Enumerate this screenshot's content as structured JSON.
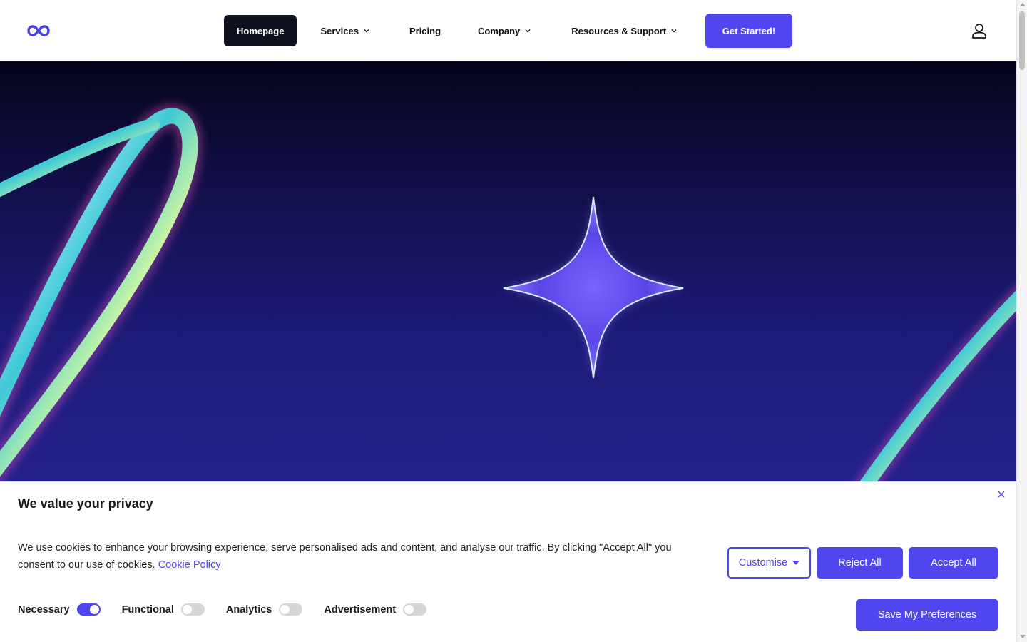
{
  "header": {
    "logo_icon": "infinity-logo-icon",
    "nav": [
      {
        "label": "Homepage",
        "active": true,
        "has_dropdown": false
      },
      {
        "label": "Services",
        "active": false,
        "has_dropdown": true
      },
      {
        "label": "Pricing",
        "active": false,
        "has_dropdown": false
      },
      {
        "label": "Company",
        "active": false,
        "has_dropdown": true
      },
      {
        "label": "Resources & Support",
        "active": false,
        "has_dropdown": true
      }
    ],
    "cta_label": "Get Started!",
    "user_icon": "user-icon"
  },
  "hero": {
    "decor_icons": [
      "sparkle-star-icon",
      "holographic-ring-left",
      "holographic-ring-right"
    ]
  },
  "cookie": {
    "title": "We value your privacy",
    "text": "We use cookies to enhance your browsing experience, serve personalised ads and content, and analyse our traffic. By clicking \"Accept All\" you consent to our use of cookies.",
    "link_label": "Cookie Policy",
    "customise_label": "Customise",
    "reject_label": "Reject All",
    "accept_label": "Accept All",
    "save_label": "Save My Preferences",
    "close_icon": "close-icon",
    "preferences": [
      {
        "label": "Necessary",
        "on": true
      },
      {
        "label": "Functional",
        "on": false
      },
      {
        "label": "Analytics",
        "on": false
      },
      {
        "label": "Advertisement",
        "on": false
      }
    ]
  },
  "colors": {
    "accent": "#5046f0",
    "nav_active_bg": "#0e1020",
    "hero_top": "#05041a",
    "hero_bottom": "#24208a"
  }
}
